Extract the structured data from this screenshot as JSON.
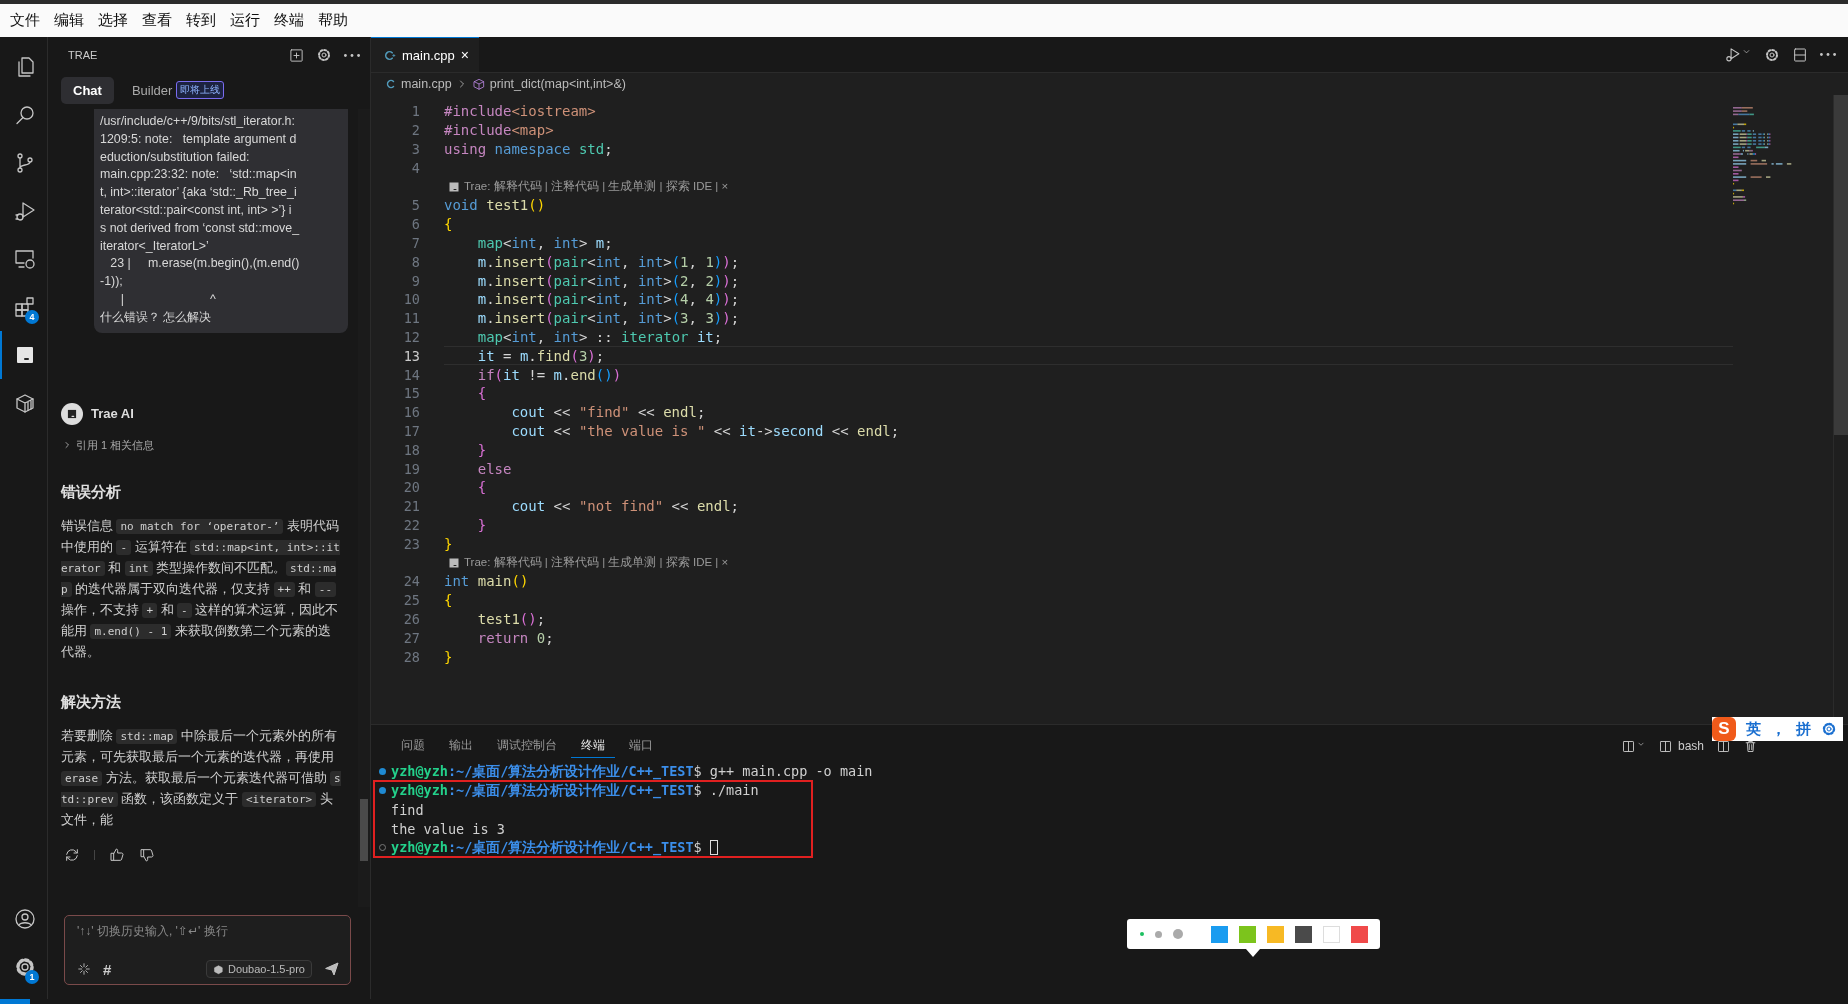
{
  "menu_bar": {
    "items": [
      "文件",
      "编辑",
      "选择",
      "查看",
      "转到",
      "运行",
      "终端",
      "帮助"
    ]
  },
  "activity_bar": {
    "items": [
      {
        "kind": "files",
        "selected": false
      },
      {
        "kind": "search",
        "selected": false
      },
      {
        "kind": "source-control",
        "selected": false
      },
      {
        "kind": "run-debug",
        "selected": false
      },
      {
        "kind": "remote",
        "selected": false
      },
      {
        "kind": "extensions",
        "selected": false,
        "badge": "4"
      },
      {
        "kind": "trae",
        "selected": true
      },
      {
        "kind": "box",
        "selected": false
      }
    ],
    "bottom": [
      {
        "kind": "account"
      },
      {
        "kind": "settings",
        "badge": "1"
      }
    ]
  },
  "chat_panel": {
    "title": "TRAE",
    "tabs": [
      {
        "label": "Chat",
        "selected": true
      },
      {
        "label": "Builder",
        "selected": false,
        "badge": "即将上线"
      }
    ],
    "user_message": {
      "lines": [
        "/usr/include/c++/9/bits/stl_iterator.h:",
        "1209:5: note:   template argument d",
        "eduction/substitution failed:",
        "main.cpp:23:32: note:   ‘std::map<in",
        "t, int>::iterator’ {aka ‘std::_Rb_tree_i",
        "terator<std::pair<const int, int> >’} i",
        "s not derived from ‘const std::move_",
        "iterator<_IteratorL>’",
        "   23 |     m.erase(m.begin(),(m.end()",
        "-1));",
        "      |                         ^",
        "什么错误？ 怎么解决"
      ]
    },
    "assistant": {
      "name": "Trae AI",
      "references": {
        "label": "引用 1 相关信息",
        "expanded": false
      },
      "sections": [
        {
          "heading": "错误分析",
          "paragraph": [
            {
              "kind": "text",
              "text": "错误信息 "
            },
            {
              "kind": "code",
              "text": "no match for ‘operator-’"
            },
            {
              "kind": "text",
              "text": " 表明代码中使用的 "
            },
            {
              "kind": "code",
              "text": "-"
            },
            {
              "kind": "text",
              "text": " 运算符在 "
            },
            {
              "kind": "code",
              "text": "std::map<int, int>::iterator"
            },
            {
              "kind": "text",
              "text": " 和 "
            },
            {
              "kind": "code",
              "text": "int"
            },
            {
              "kind": "text",
              "text": " 类型操作数间不匹配。"
            },
            {
              "kind": "code",
              "text": "std::map"
            },
            {
              "kind": "text",
              "text": " 的迭代器属于双向迭代器，仅支持 "
            },
            {
              "kind": "code",
              "text": "++"
            },
            {
              "kind": "text",
              "text": " 和 "
            },
            {
              "kind": "code",
              "text": "--"
            },
            {
              "kind": "text",
              "text": " 操作，不支持 "
            },
            {
              "kind": "code",
              "text": "+"
            },
            {
              "kind": "text",
              "text": " 和 "
            },
            {
              "kind": "code",
              "text": "-"
            },
            {
              "kind": "text",
              "text": " 这样的算术运算，因此不能用 "
            },
            {
              "kind": "code",
              "text": "m.end() - 1"
            },
            {
              "kind": "text",
              "text": " 来获取倒数第二个元素的迭代器。"
            }
          ]
        },
        {
          "heading": "解决方法",
          "paragraph": [
            {
              "kind": "text",
              "text": "若要删除 "
            },
            {
              "kind": "code",
              "text": "std::map"
            },
            {
              "kind": "text",
              "text": " 中除最后一个元素外的所有元素，可先获取最后一个元素的迭代器，再使用 "
            },
            {
              "kind": "code",
              "text": "erase"
            },
            {
              "kind": "text",
              "text": " 方法。获取最后一个元素迭代器可借助 "
            },
            {
              "kind": "code",
              "text": "std::prev"
            },
            {
              "kind": "text",
              "text": " 函数，该函数定义于 "
            },
            {
              "kind": "code",
              "text": "<iterator>"
            },
            {
              "kind": "text",
              "text": " 头文件，能"
            }
          ]
        }
      ]
    },
    "input": {
      "placeholder": "'↑↓' 切换历史输入, '⇧↵' 换行",
      "hash": "#",
      "model": "Doubao-1.5-pro"
    }
  },
  "editor": {
    "tabs": [
      {
        "label": "main.cpp",
        "selected": true,
        "close": "×"
      }
    ],
    "breadcrumb": [
      "main.cpp",
      "print_dict(map<int,int>&)"
    ],
    "rows": [
      {
        "kind": "code",
        "number": "1",
        "current": false,
        "tokens": [
          {
            "text": "#include",
            "kind": "pre"
          },
          {
            "text": "<iostream>",
            "kind": "str"
          }
        ]
      },
      {
        "kind": "code",
        "number": "2",
        "current": false,
        "tokens": [
          {
            "text": "#include",
            "kind": "pre"
          },
          {
            "text": "<map>",
            "kind": "str"
          }
        ]
      },
      {
        "kind": "code",
        "number": "3",
        "current": false,
        "tokens": [
          {
            "text": "using",
            "kind": "ctrl"
          },
          {
            "text": " namespace",
            "kind": "kw"
          },
          {
            "text": " std",
            "kind": "type"
          },
          {
            "text": ";",
            "kind": "plain"
          }
        ]
      },
      {
        "kind": "code",
        "number": "4",
        "current": false
      },
      {
        "kind": "lens",
        "text": "Trae: 解释代码 | 注释代码 | 生成单测 | 探索 IDE | ×"
      },
      {
        "kind": "code",
        "number": "5",
        "current": false,
        "tokens": [
          {
            "text": "void",
            "kind": "kw"
          },
          {
            "text": " test1",
            "kind": "fn"
          },
          {
            "text": "()",
            "kind": "b1"
          }
        ]
      },
      {
        "kind": "code",
        "number": "6",
        "current": false,
        "tokens": [
          {
            "text": "{",
            "kind": "b1"
          }
        ]
      },
      {
        "kind": "code",
        "number": "7",
        "current": false,
        "tokens": [
          {
            "text": "    map",
            "kind": "type"
          },
          {
            "text": "<",
            "kind": "plain"
          },
          {
            "text": "int",
            "kind": "kw"
          },
          {
            "text": ", ",
            "kind": "plain"
          },
          {
            "text": "int",
            "kind": "kw"
          },
          {
            "text": "> ",
            "kind": "plain"
          },
          {
            "text": "m",
            "kind": "var"
          },
          {
            "text": ";",
            "kind": "plain"
          }
        ]
      },
      {
        "kind": "code",
        "number": "8",
        "current": false,
        "tokens": [
          {
            "text": "    m",
            "kind": "var"
          },
          {
            "text": ".",
            "kind": "plain"
          },
          {
            "text": "insert",
            "kind": "fn"
          },
          {
            "text": "(",
            "kind": "b2"
          },
          {
            "text": "pair",
            "kind": "type"
          },
          {
            "text": "<",
            "kind": "plain"
          },
          {
            "text": "int",
            "kind": "kw"
          },
          {
            "text": ", ",
            "kind": "plain"
          },
          {
            "text": "int",
            "kind": "kw"
          },
          {
            "text": ">",
            "kind": "plain"
          },
          {
            "text": "(",
            "kind": "b3"
          },
          {
            "text": "1",
            "kind": "num"
          },
          {
            "text": ", ",
            "kind": "plain"
          },
          {
            "text": "1",
            "kind": "num"
          },
          {
            "text": ")",
            "kind": "b3"
          },
          {
            "text": ")",
            "kind": "b2"
          },
          {
            "text": ";",
            "kind": "plain"
          }
        ]
      },
      {
        "kind": "code",
        "number": "9",
        "current": false,
        "tokens": [
          {
            "text": "    m",
            "kind": "var"
          },
          {
            "text": ".",
            "kind": "plain"
          },
          {
            "text": "insert",
            "kind": "fn"
          },
          {
            "text": "(",
            "kind": "b2"
          },
          {
            "text": "pair",
            "kind": "type"
          },
          {
            "text": "<",
            "kind": "plain"
          },
          {
            "text": "int",
            "kind": "kw"
          },
          {
            "text": ", ",
            "kind": "plain"
          },
          {
            "text": "int",
            "kind": "kw"
          },
          {
            "text": ">",
            "kind": "plain"
          },
          {
            "text": "(",
            "kind": "b3"
          },
          {
            "text": "2",
            "kind": "num"
          },
          {
            "text": ", ",
            "kind": "plain"
          },
          {
            "text": "2",
            "kind": "num"
          },
          {
            "text": ")",
            "kind": "b3"
          },
          {
            "text": ")",
            "kind": "b2"
          },
          {
            "text": ";",
            "kind": "plain"
          }
        ]
      },
      {
        "kind": "code",
        "number": "10",
        "current": false,
        "tokens": [
          {
            "text": "    m",
            "kind": "var"
          },
          {
            "text": ".",
            "kind": "plain"
          },
          {
            "text": "insert",
            "kind": "fn"
          },
          {
            "text": "(",
            "kind": "b2"
          },
          {
            "text": "pair",
            "kind": "type"
          },
          {
            "text": "<",
            "kind": "plain"
          },
          {
            "text": "int",
            "kind": "kw"
          },
          {
            "text": ", ",
            "kind": "plain"
          },
          {
            "text": "int",
            "kind": "kw"
          },
          {
            "text": ">",
            "kind": "plain"
          },
          {
            "text": "(",
            "kind": "b3"
          },
          {
            "text": "4",
            "kind": "num"
          },
          {
            "text": ", ",
            "kind": "plain"
          },
          {
            "text": "4",
            "kind": "num"
          },
          {
            "text": ")",
            "kind": "b3"
          },
          {
            "text": ")",
            "kind": "b2"
          },
          {
            "text": ";",
            "kind": "plain"
          }
        ]
      },
      {
        "kind": "code",
        "number": "11",
        "current": false,
        "tokens": [
          {
            "text": "    m",
            "kind": "var"
          },
          {
            "text": ".",
            "kind": "plain"
          },
          {
            "text": "insert",
            "kind": "fn"
          },
          {
            "text": "(",
            "kind": "b2"
          },
          {
            "text": "pair",
            "kind": "type"
          },
          {
            "text": "<",
            "kind": "plain"
          },
          {
            "text": "int",
            "kind": "kw"
          },
          {
            "text": ", ",
            "kind": "plain"
          },
          {
            "text": "int",
            "kind": "kw"
          },
          {
            "text": ">",
            "kind": "plain"
          },
          {
            "text": "(",
            "kind": "b3"
          },
          {
            "text": "3",
            "kind": "num"
          },
          {
            "text": ", ",
            "kind": "plain"
          },
          {
            "text": "3",
            "kind": "num"
          },
          {
            "text": ")",
            "kind": "b3"
          },
          {
            "text": ")",
            "kind": "b2"
          },
          {
            "text": ";",
            "kind": "plain"
          }
        ]
      },
      {
        "kind": "code",
        "number": "12",
        "current": false,
        "tokens": [
          {
            "text": "    map",
            "kind": "type"
          },
          {
            "text": "<",
            "kind": "plain"
          },
          {
            "text": "int",
            "kind": "kw"
          },
          {
            "text": ", ",
            "kind": "plain"
          },
          {
            "text": "int",
            "kind": "kw"
          },
          {
            "text": "> :: ",
            "kind": "plain"
          },
          {
            "text": "iterator",
            "kind": "type"
          },
          {
            "text": " it",
            "kind": "var"
          },
          {
            "text": ";",
            "kind": "plain"
          }
        ]
      },
      {
        "kind": "code",
        "number": "13",
        "current": true,
        "tokens": [
          {
            "text": "    it",
            "kind": "var"
          },
          {
            "text": " = ",
            "kind": "plain"
          },
          {
            "text": "m",
            "kind": "var"
          },
          {
            "text": ".",
            "kind": "plain"
          },
          {
            "text": "find",
            "kind": "fn"
          },
          {
            "text": "(",
            "kind": "b2"
          },
          {
            "text": "3",
            "kind": "num"
          },
          {
            "text": ")",
            "kind": "b2"
          },
          {
            "text": ";",
            "kind": "plain"
          }
        ]
      },
      {
        "kind": "code",
        "number": "14",
        "current": false,
        "tokens": [
          {
            "text": "    if",
            "kind": "ctrl"
          },
          {
            "text": "(",
            "kind": "b2"
          },
          {
            "text": "it",
            "kind": "var"
          },
          {
            "text": " != ",
            "kind": "plain"
          },
          {
            "text": "m",
            "kind": "var"
          },
          {
            "text": ".",
            "kind": "plain"
          },
          {
            "text": "end",
            "kind": "fn"
          },
          {
            "text": "()",
            "kind": "b3"
          },
          {
            "text": ")",
            "kind": "b2"
          }
        ]
      },
      {
        "kind": "code",
        "number": "15",
        "current": false,
        "tokens": [
          {
            "text": "    {",
            "kind": "b2"
          }
        ]
      },
      {
        "kind": "code",
        "number": "16",
        "current": false,
        "tokens": [
          {
            "text": "        cout",
            "kind": "var"
          },
          {
            "text": " << ",
            "kind": "plain"
          },
          {
            "text": "\"find\"",
            "kind": "str"
          },
          {
            "text": " << ",
            "kind": "plain"
          },
          {
            "text": "endl",
            "kind": "fn"
          },
          {
            "text": ";",
            "kind": "plain"
          }
        ]
      },
      {
        "kind": "code",
        "number": "17",
        "current": false,
        "tokens": [
          {
            "text": "        cout",
            "kind": "var"
          },
          {
            "text": " << ",
            "kind": "plain"
          },
          {
            "text": "\"the value is \"",
            "kind": "str"
          },
          {
            "text": " << ",
            "kind": "plain"
          },
          {
            "text": "it",
            "kind": "var"
          },
          {
            "text": "->",
            "kind": "plain"
          },
          {
            "text": "second",
            "kind": "var"
          },
          {
            "text": " << ",
            "kind": "plain"
          },
          {
            "text": "endl",
            "kind": "fn"
          },
          {
            "text": ";",
            "kind": "plain"
          }
        ]
      },
      {
        "kind": "code",
        "number": "18",
        "current": false,
        "tokens": [
          {
            "text": "    }",
            "kind": "b2"
          }
        ]
      },
      {
        "kind": "code",
        "number": "19",
        "current": false,
        "tokens": [
          {
            "text": "    else",
            "kind": "ctrl"
          }
        ]
      },
      {
        "kind": "code",
        "number": "20",
        "current": false,
        "tokens": [
          {
            "text": "    {",
            "kind": "b2"
          }
        ]
      },
      {
        "kind": "code",
        "number": "21",
        "current": false,
        "tokens": [
          {
            "text": "        cout",
            "kind": "var"
          },
          {
            "text": " << ",
            "kind": "plain"
          },
          {
            "text": "\"not find\"",
            "kind": "str"
          },
          {
            "text": " << ",
            "kind": "plain"
          },
          {
            "text": "endl",
            "kind": "fn"
          },
          {
            "text": ";",
            "kind": "plain"
          }
        ]
      },
      {
        "kind": "code",
        "number": "22",
        "current": false,
        "tokens": [
          {
            "text": "    }",
            "kind": "b2"
          }
        ]
      },
      {
        "kind": "code",
        "number": "23",
        "current": false,
        "tokens": [
          {
            "text": "}",
            "kind": "b1"
          }
        ]
      },
      {
        "kind": "lens",
        "text": "Trae: 解释代码 | 注释代码 | 生成单测 | 探索 IDE | ×"
      },
      {
        "kind": "code",
        "number": "24",
        "current": false,
        "tokens": [
          {
            "text": "int",
            "kind": "kw"
          },
          {
            "text": " main",
            "kind": "fn"
          },
          {
            "text": "()",
            "kind": "b1"
          }
        ]
      },
      {
        "kind": "code",
        "number": "25",
        "current": false,
        "tokens": [
          {
            "text": "{",
            "kind": "b1"
          }
        ]
      },
      {
        "kind": "code",
        "number": "26",
        "current": false,
        "tokens": [
          {
            "text": "    test1",
            "kind": "fn"
          },
          {
            "text": "()",
            "kind": "b2"
          },
          {
            "text": ";",
            "kind": "plain"
          }
        ]
      },
      {
        "kind": "code",
        "number": "27",
        "current": false,
        "tokens": [
          {
            "text": "    return",
            "kind": "ctrl"
          },
          {
            "text": " 0",
            "kind": "num"
          },
          {
            "text": ";",
            "kind": "plain"
          }
        ]
      },
      {
        "kind": "code",
        "number": "28",
        "current": false,
        "tokens": [
          {
            "text": "}",
            "kind": "b1"
          }
        ]
      }
    ]
  },
  "panel": {
    "tabs": [
      {
        "label": "问题",
        "selected": false
      },
      {
        "label": "输出",
        "selected": false
      },
      {
        "label": "调试控制台",
        "selected": false
      },
      {
        "label": "终端",
        "selected": true
      },
      {
        "label": "端口",
        "selected": false
      }
    ],
    "shell": "bash",
    "lines": [
      {
        "kind": "prompt",
        "succeeded": true,
        "user": "yzh@yzh",
        "path": ":~/桌面/算法分析设计作业/C++_TEST",
        "command": "$ g++ main.cpp -o main",
        "cursor": false
      },
      {
        "kind": "prompt",
        "succeeded": true,
        "user": "yzh@yzh",
        "path": ":~/桌面/算法分析设计作业/C++_TEST",
        "command": "$ ./main",
        "cursor": false
      },
      {
        "kind": "output",
        "text": "find"
      },
      {
        "kind": "output",
        "text": "the value is 3"
      },
      {
        "kind": "prompt",
        "succeeded": false,
        "user": "yzh@yzh",
        "path": ":~/桌面/算法分析设计作业/C++_TEST",
        "command": "$",
        "cursor": true
      }
    ]
  },
  "input_method_bar": {
    "logo": "S",
    "items": [
      "英",
      "，",
      "拼"
    ]
  },
  "annotation_toolbar": {
    "pen_sizes": [
      {
        "selected": true
      },
      {
        "selected": false
      },
      {
        "selected": false
      }
    ],
    "colors": [
      {
        "color": "#1a9cf0",
        "selected": false
      },
      {
        "color": "#7cc41c",
        "selected": false
      },
      {
        "color": "#f7b924",
        "selected": false
      },
      {
        "color": "#4a4a4a",
        "selected": false
      },
      {
        "color": "#ffffff",
        "selected": false
      },
      {
        "color": "#f04a4a",
        "selected": false
      }
    ]
  }
}
